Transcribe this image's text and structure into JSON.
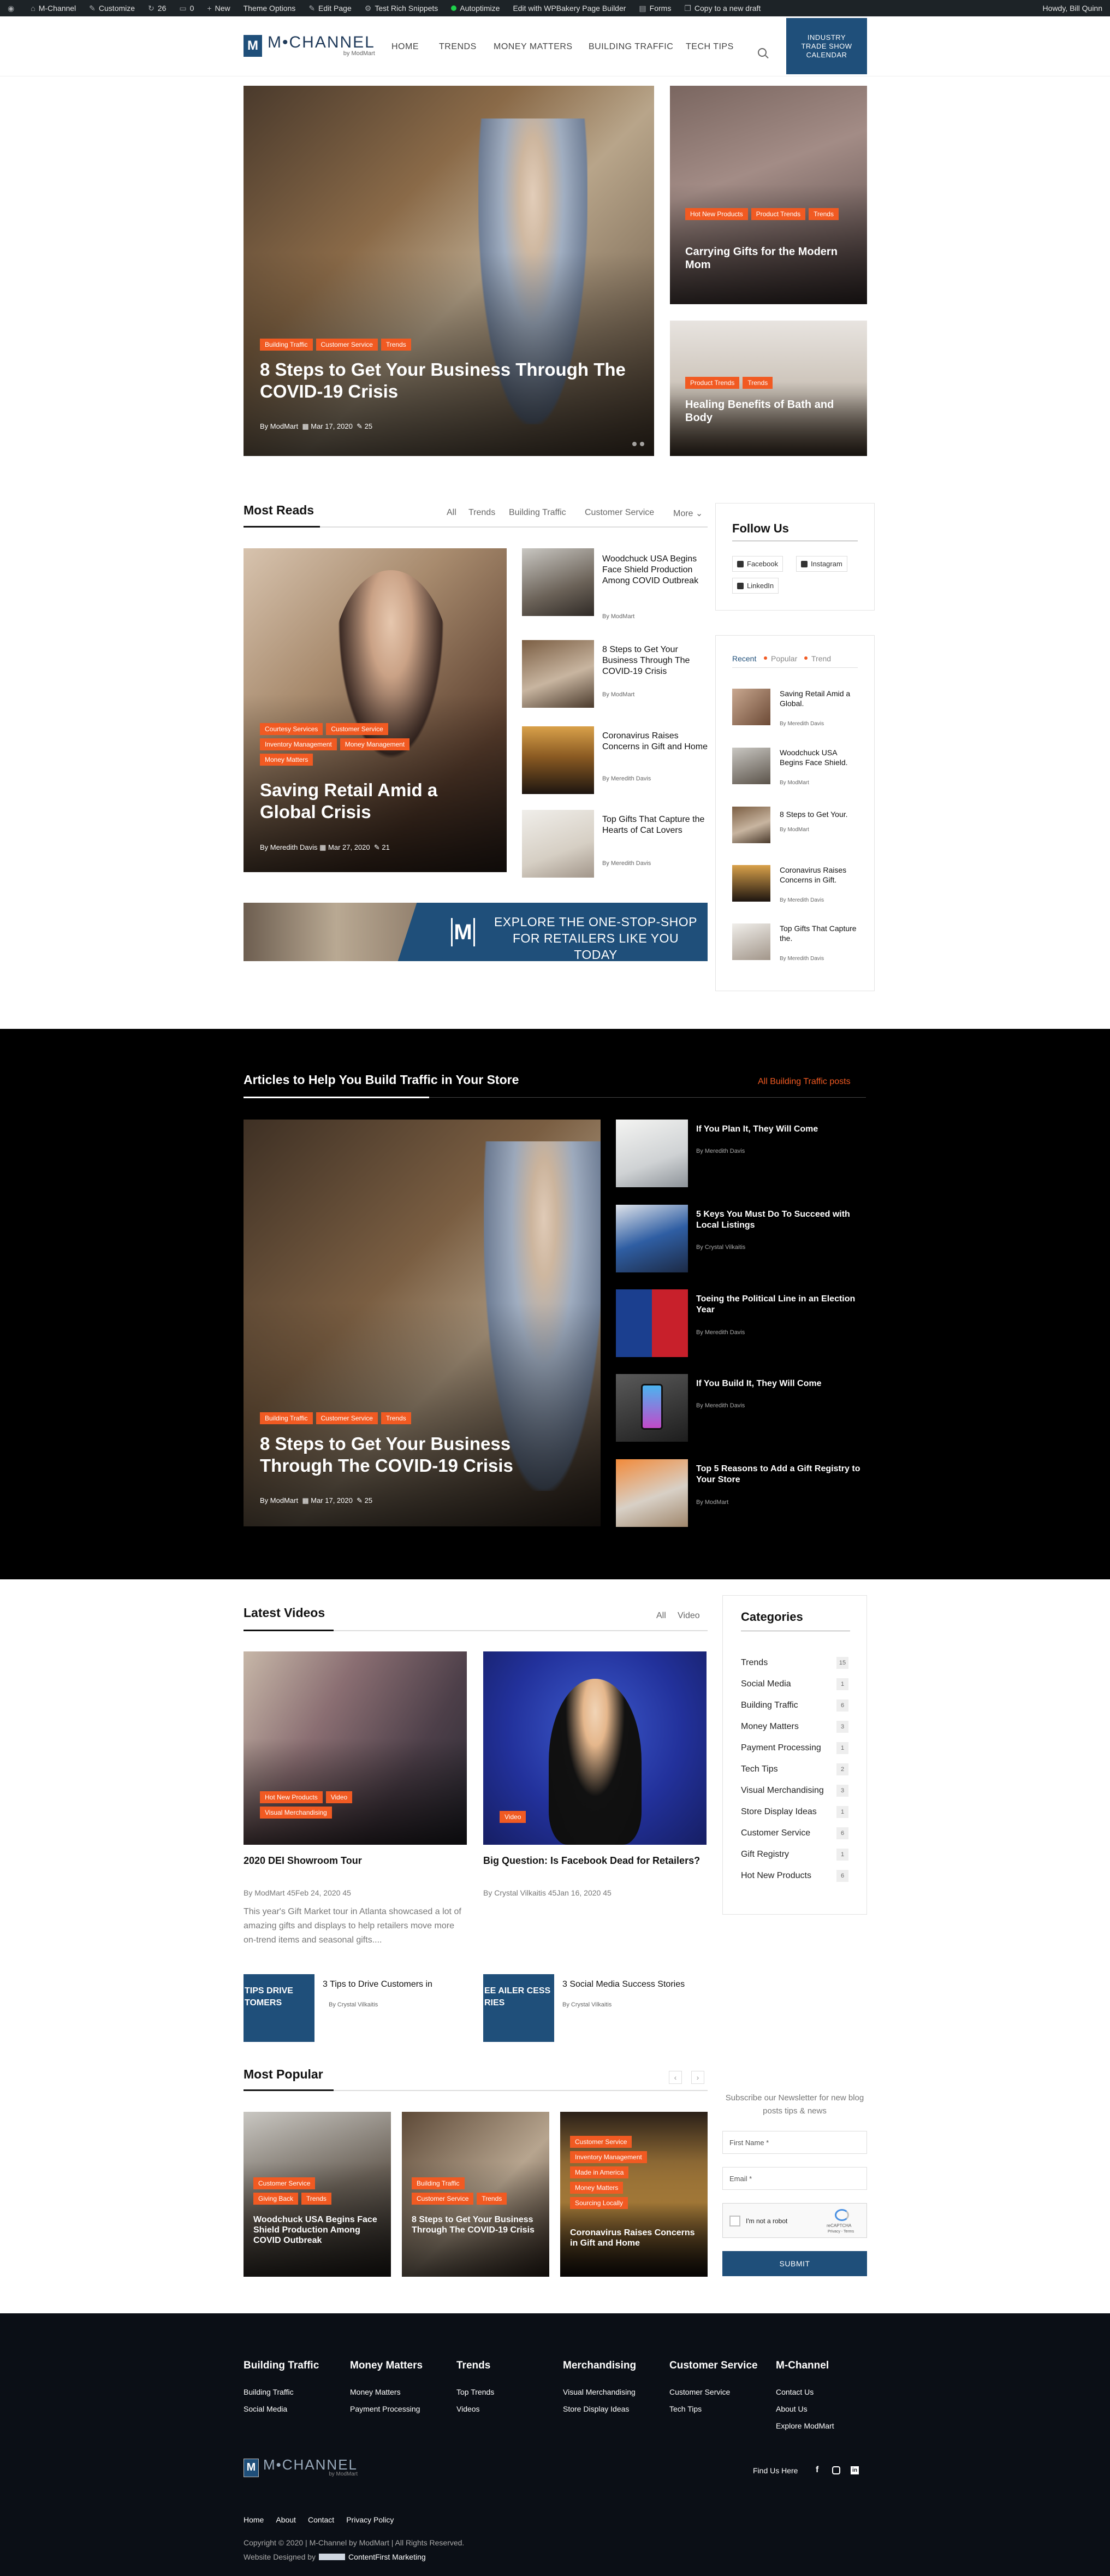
{
  "admin_bar": {
    "site": "M-Channel",
    "customize": "Customize",
    "updates": "26",
    "comments": "0",
    "new": "New",
    "theme_options": "Theme Options",
    "edit_page": "Edit Page",
    "test_snippets": "Test Rich Snippets",
    "autoptimize": "Autoptimize",
    "wpbakery": "Edit with WPBakery Page Builder",
    "forms": "Forms",
    "copy_draft": "Copy to a new draft",
    "howdy": "Howdy, Bill Quinn"
  },
  "header": {
    "logo_text": "M•CHANNEL",
    "logo_sub": "by ModMart",
    "nav": [
      "HOME",
      "TRENDS",
      "MONEY MATTERS",
      "BUILDING TRAFFIC",
      "TECH TIPS"
    ],
    "cta": "INDUSTRY TRADE SHOW CALENDAR"
  },
  "hero": {
    "main": {
      "tags": [
        "Building Traffic",
        "Customer Service",
        "Trends"
      ],
      "title": "8 Steps to Get Your Business Through The COVID-19 Crisis",
      "author": "By ModMart",
      "date": "Mar 17, 2020",
      "comments": "25"
    },
    "side1": {
      "tags": [
        "Hot New Products",
        "Product Trends",
        "Trends"
      ],
      "title": "Carrying Gifts for the Modern Mom"
    },
    "side2": {
      "tags": [
        "Product Trends",
        "Trends"
      ],
      "title": "Healing Benefits of Bath and Body"
    }
  },
  "most_reads": {
    "title": "Most Reads",
    "filters": [
      "All",
      "Trends",
      "Building Traffic",
      "Customer Service",
      "More"
    ],
    "feature": {
      "tags": [
        "Courtesy Services",
        "Customer Service",
        "Inventory Management",
        "Money Management",
        "Money Matters"
      ],
      "title": "Saving Retail Amid a Global Crisis",
      "author": "By Meredith Davis",
      "date": "Mar 27, 2020",
      "comments": "21"
    },
    "list": [
      {
        "title": "Woodchuck USA Begins Face Shield Production Among COVID Outbreak",
        "author": "By ModMart"
      },
      {
        "title": "8 Steps to Get Your Business Through The COVID-19 Crisis",
        "author": "By ModMart"
      },
      {
        "title": "Coronavirus Raises Concerns in Gift and Home",
        "author": "By Meredith Davis"
      },
      {
        "title": "Top Gifts That Capture the Hearts of Cat Lovers",
        "author": "By Meredith Davis"
      }
    ]
  },
  "banner": {
    "line1": "EXPLORE THE ONE-STOP-SHOP",
    "line2": "FOR RETAILERS LIKE YOU TODAY"
  },
  "follow": {
    "title": "Follow Us",
    "facebook": "Facebook",
    "instagram": "Instagram",
    "linkedin": "LinkedIn"
  },
  "recent_widget": {
    "tabs": [
      "Recent",
      "Popular",
      "Trend"
    ],
    "items": [
      {
        "title": "Saving Retail Amid a Global.",
        "author": "By Meredith Davis"
      },
      {
        "title": "Woodchuck USA Begins Face Shield.",
        "author": "By ModMart"
      },
      {
        "title": "8 Steps to Get Your.",
        "author": "By ModMart"
      },
      {
        "title": "Coronavirus Raises Concerns in Gift.",
        "author": "By Meredith Davis"
      },
      {
        "title": "Top Gifts That Capture the.",
        "author": "By Meredith Davis"
      }
    ]
  },
  "traffic": {
    "title": "Articles to Help You Build Traffic in Your Store",
    "all_link": "All Building Traffic posts",
    "feature": {
      "tags": [
        "Building Traffic",
        "Customer Service",
        "Trends"
      ],
      "title": "8 Steps to Get Your Business Through The COVID-19 Crisis",
      "author": "By ModMart",
      "date": "Mar 17, 2020",
      "comments": "25"
    },
    "list": [
      {
        "title": "If You Plan It, They Will Come",
        "author": "By Meredith Davis"
      },
      {
        "title": "5 Keys You Must Do To Succeed with Local Listings",
        "author": "By Crystal Vilkaitis"
      },
      {
        "title": "Toeing the Political Line in an Election Year",
        "author": "By Meredith Davis"
      },
      {
        "title": "If You Build It, They Will Come",
        "author": "By Meredith Davis"
      },
      {
        "title": "Top 5 Reasons to Add a Gift Registry to Your Store",
        "author": "By ModMart"
      }
    ]
  },
  "videos": {
    "title": "Latest Videos",
    "filters": [
      "All",
      "Video"
    ],
    "cards": [
      {
        "tags": [
          "Hot New Products",
          "Video",
          "Visual Merchandising"
        ],
        "title": "2020 DEI Showroom Tour",
        "meta": "By ModMart  45Feb 24, 2020  45",
        "excerpt": "This year's Gift Market tour in Atlanta showcased a lot of amazing gifts and displays to help retailers move more on-trend items and seasonal gifts...."
      },
      {
        "tags": [
          "Video"
        ],
        "title": "Big Question: Is Facebook Dead for Retailers?",
        "meta": "By Crystal Vilkaitis  45Jan 16, 2020  45",
        "excerpt": ""
      }
    ],
    "small": [
      {
        "title": "3 Tips to Drive Customers in",
        "author": "By Crystal Vilkaitis",
        "thumb": "TIPS DRIVE TOMERS"
      },
      {
        "title": "3 Social Media Success Stories",
        "author": "By Crystal Vilkaitis",
        "thumb": "EE AILER CESS RIES"
      }
    ]
  },
  "categories": {
    "title": "Categories",
    "items": [
      {
        "name": "Trends",
        "count": "15"
      },
      {
        "name": "Social Media",
        "count": "1"
      },
      {
        "name": "Building Traffic",
        "count": "6"
      },
      {
        "name": "Money Matters",
        "count": "3"
      },
      {
        "name": "Payment Processing",
        "count": "1"
      },
      {
        "name": "Tech Tips",
        "count": "2"
      },
      {
        "name": "Visual Merchandising",
        "count": "3"
      },
      {
        "name": "Store Display Ideas",
        "count": "1"
      },
      {
        "name": "Customer Service",
        "count": "6"
      },
      {
        "name": "Gift Registry",
        "count": "1"
      },
      {
        "name": "Hot New Products",
        "count": "6"
      }
    ]
  },
  "popular": {
    "title": "Most Popular",
    "cards": [
      {
        "tags": [
          "Customer Service",
          "Giving Back",
          "Trends"
        ],
        "title": "Woodchuck USA Begins Face Shield Production Among COVID Outbreak"
      },
      {
        "tags": [
          "Building Traffic",
          "Customer Service",
          "Trends"
        ],
        "title": "8 Steps to Get Your Business Through The COVID-19 Crisis"
      },
      {
        "tags": [
          "Customer Service",
          "Inventory Management",
          "Made in America",
          "Money Matters",
          "Sourcing Locally"
        ],
        "title": "Coronavirus Raises Concerns in Gift and Home"
      }
    ]
  },
  "newsletter": {
    "text": "Subscribe our Newsletter for new blog posts tips & news",
    "first_name": "First Name *",
    "email": "Email *",
    "captcha": "I'm not a robot",
    "captcha_brand": "reCAPTCHA",
    "captcha_links": "Privacy - Terms",
    "submit": "SUBMIT"
  },
  "footer": {
    "columns": [
      {
        "heading": "Building Traffic",
        "links": [
          "Building Traffic",
          "Social Media"
        ]
      },
      {
        "heading": "Money Matters",
        "links": [
          "Money Matters",
          "Payment Processing"
        ]
      },
      {
        "heading": "Trends",
        "links": [
          "Top Trends",
          "Videos"
        ]
      },
      {
        "heading": "Merchandising",
        "links": [
          "Visual Merchandising",
          "Store Display Ideas"
        ]
      },
      {
        "heading": "Customer Service",
        "links": [
          "Customer Service",
          "Tech Tips"
        ]
      },
      {
        "heading": "M-Channel",
        "links": [
          "Contact Us",
          "About Us",
          "Explore ModMart"
        ]
      }
    ],
    "find_us": "Find Us Here",
    "bottom_links": [
      "Home",
      "About",
      "Contact",
      "Privacy Policy"
    ],
    "copyright": "Copyright © 2020 | M-Channel by ModMart | All Rights Reserved.",
    "designed_by": "Website Designed by",
    "designer": "ContentFirst Marketing"
  }
}
